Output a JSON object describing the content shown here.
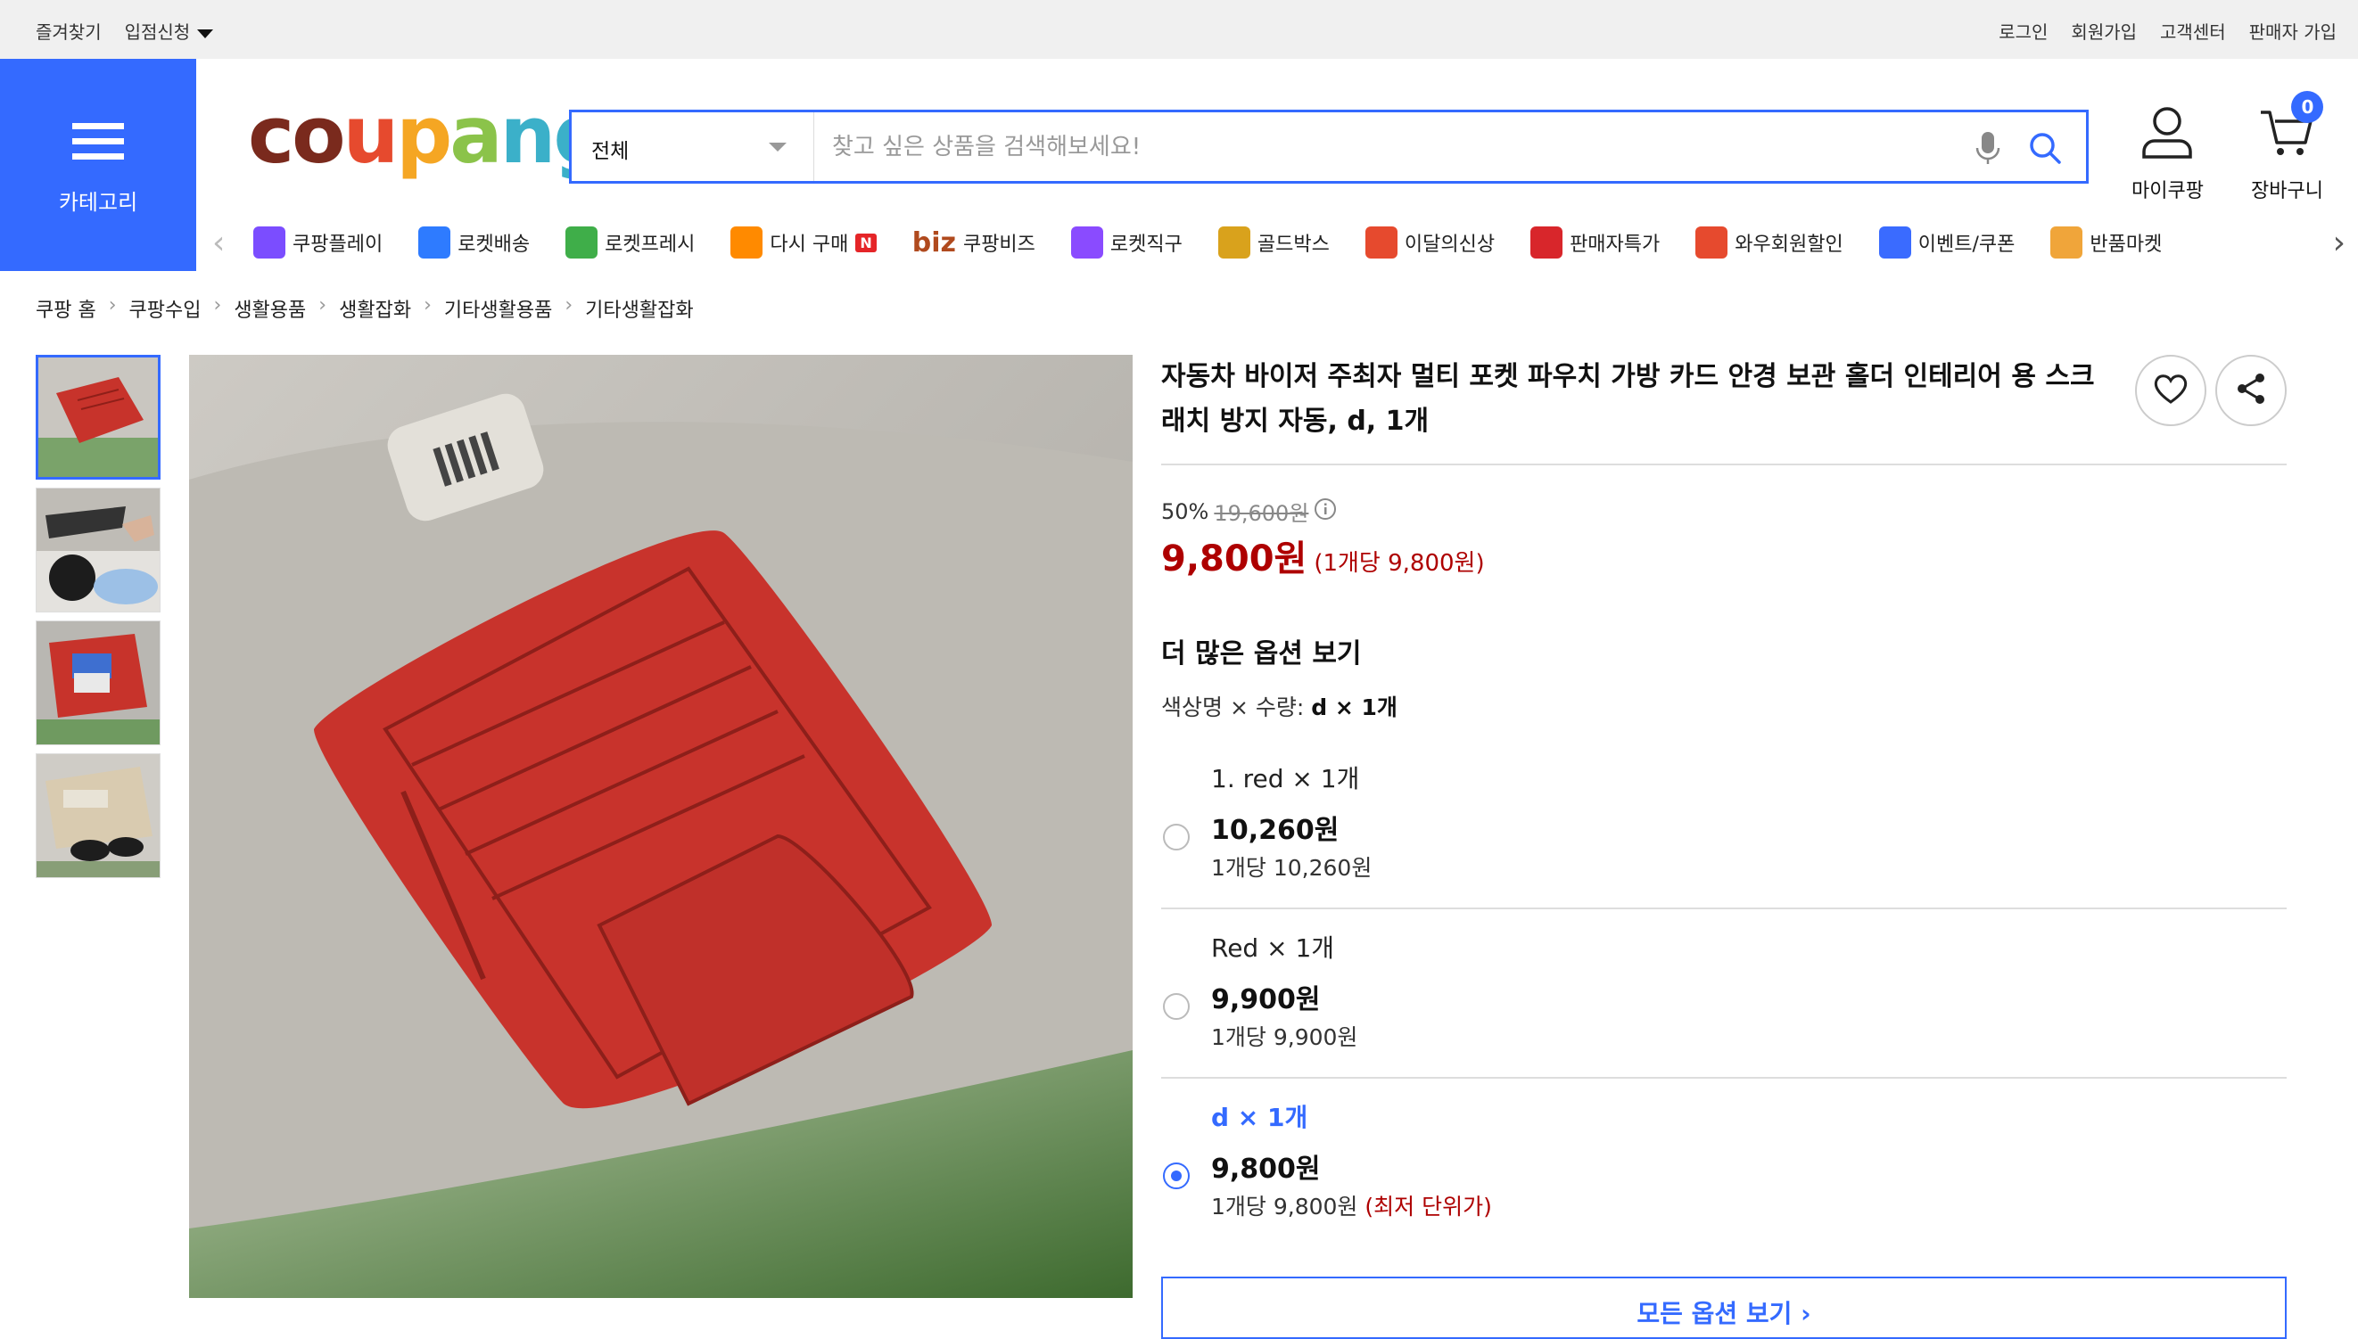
{
  "topbar": {
    "left": [
      "즐겨찾기",
      "입점신청"
    ],
    "right": [
      "로그인",
      "회원가입",
      "고객센터",
      "판매자 가입"
    ]
  },
  "category_button": {
    "label": "카테고리"
  },
  "logo": {
    "text": "coupang"
  },
  "search": {
    "scope": "전체",
    "placeholder": "찾고 싶은 상품을 검색해보세요!"
  },
  "header_icons": {
    "mypage": "마이쿠팡",
    "cart": "장바구니",
    "cart_count": "0"
  },
  "nav": {
    "items": [
      {
        "label": "쿠팡플레이",
        "icon": "play-icon",
        "color": "#7b4dff"
      },
      {
        "label": "로켓배송",
        "icon": "rocket-icon",
        "color": "#2e7bff"
      },
      {
        "label": "로켓프레시",
        "icon": "rocket-fresh-icon",
        "color": "#3fae49"
      },
      {
        "label": "다시 구매",
        "icon": "basket-icon",
        "color": "#ff8a00",
        "badge": "N"
      },
      {
        "label": "쿠팡비즈",
        "icon": "biz-icon",
        "color": "#b04a1e",
        "prefix": "biz"
      },
      {
        "label": "로켓직구",
        "icon": "global-rocket-icon",
        "color": "#8a4bff"
      },
      {
        "label": "골드박스",
        "icon": "goldbox-icon",
        "color": "#d9a21c"
      },
      {
        "label": "이달의신상",
        "icon": "new-icon",
        "color": "#e64a2e"
      },
      {
        "label": "판매자특가",
        "icon": "percent-icon",
        "color": "#d8262b"
      },
      {
        "label": "와우회원할인",
        "icon": "wow-icon",
        "color": "#e64a2e"
      },
      {
        "label": "이벤트/쿠폰",
        "icon": "coupon-icon",
        "color": "#3a6bff"
      },
      {
        "label": "반품마켓",
        "icon": "return-market-icon",
        "color": "#f0a53a"
      }
    ]
  },
  "breadcrumb": [
    "쿠팡 홈",
    "쿠팡수입",
    "생활용품",
    "생활잡화",
    "기타생활용품",
    "기타생활잡화"
  ],
  "product": {
    "title": "자동차 바이저 주최자 멀티 포켓 파우치 가방 카드 안경 보관 홀더 인테리어 용 스크래치 방지 자동, d, 1개",
    "discount_rate": "50%",
    "original_price": "19,600원",
    "price": "9,800원",
    "unit_price": "(1개당 9,800원)",
    "more_options_label": "더 많은 옵션 보기",
    "option_summary_label": "색상명 × 수량:",
    "option_summary_value": "d × 1개",
    "options": [
      {
        "name": "1. red × 1개",
        "price": "10,260원",
        "per": "1개당 10,260원",
        "selected": false,
        "note": ""
      },
      {
        "name": "Red × 1개",
        "price": "9,900원",
        "per": "1개당 9,900원",
        "selected": false,
        "note": ""
      },
      {
        "name": "d × 1개",
        "price": "9,800원",
        "per": "1개당 9,800원",
        "selected": true,
        "note": "(최저 단위가)"
      }
    ],
    "all_options_button": "모든 옵션 보기 ›"
  },
  "colors": {
    "accent": "#346aff",
    "price_red": "#ae0000"
  }
}
